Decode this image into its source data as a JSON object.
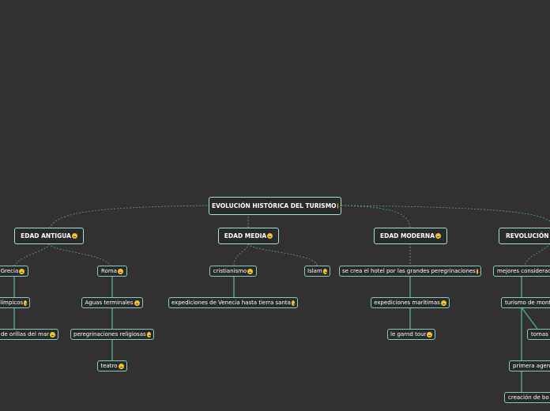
{
  "root": {
    "label": "EVOLUCIÓN HISTÓRICA DEL TURISMO"
  },
  "branches": [
    {
      "label": "EDAD ANTIGUA"
    },
    {
      "label": "EDAD MEDIA"
    },
    {
      "label": "EDAD MODERNA"
    },
    {
      "label": "REVOLUCIÓN I"
    }
  ],
  "antigua": {
    "grecia": "Grecia",
    "juegos": "olímpicos",
    "orillas": "de orillas del mar",
    "roma": "Roma",
    "aguas": "Aguas terminales",
    "peregrinaciones": "peregrinaciones religiosas",
    "teatro": "teatro"
  },
  "media": {
    "cristianismo": "cristianismo",
    "islam": "Islam",
    "expediciones": "expediciones de Venecia hasta tierra santa"
  },
  "moderna": {
    "hotel": "se crea el hotel por las grandes peregrinaciones",
    "maritimas": "expediciones marítimas",
    "grand_tour": "le garnd tour"
  },
  "revolucion": {
    "mejores": "mejores considerac",
    "montana": "turismo de mont",
    "tomas": "tomas",
    "agencia": "primera agenc",
    "creacion": "creación de bo"
  },
  "colors": {
    "background": "#323030",
    "node_border": "#7ecfc0",
    "link": "#4fa898",
    "emoji": "#f2c230"
  }
}
